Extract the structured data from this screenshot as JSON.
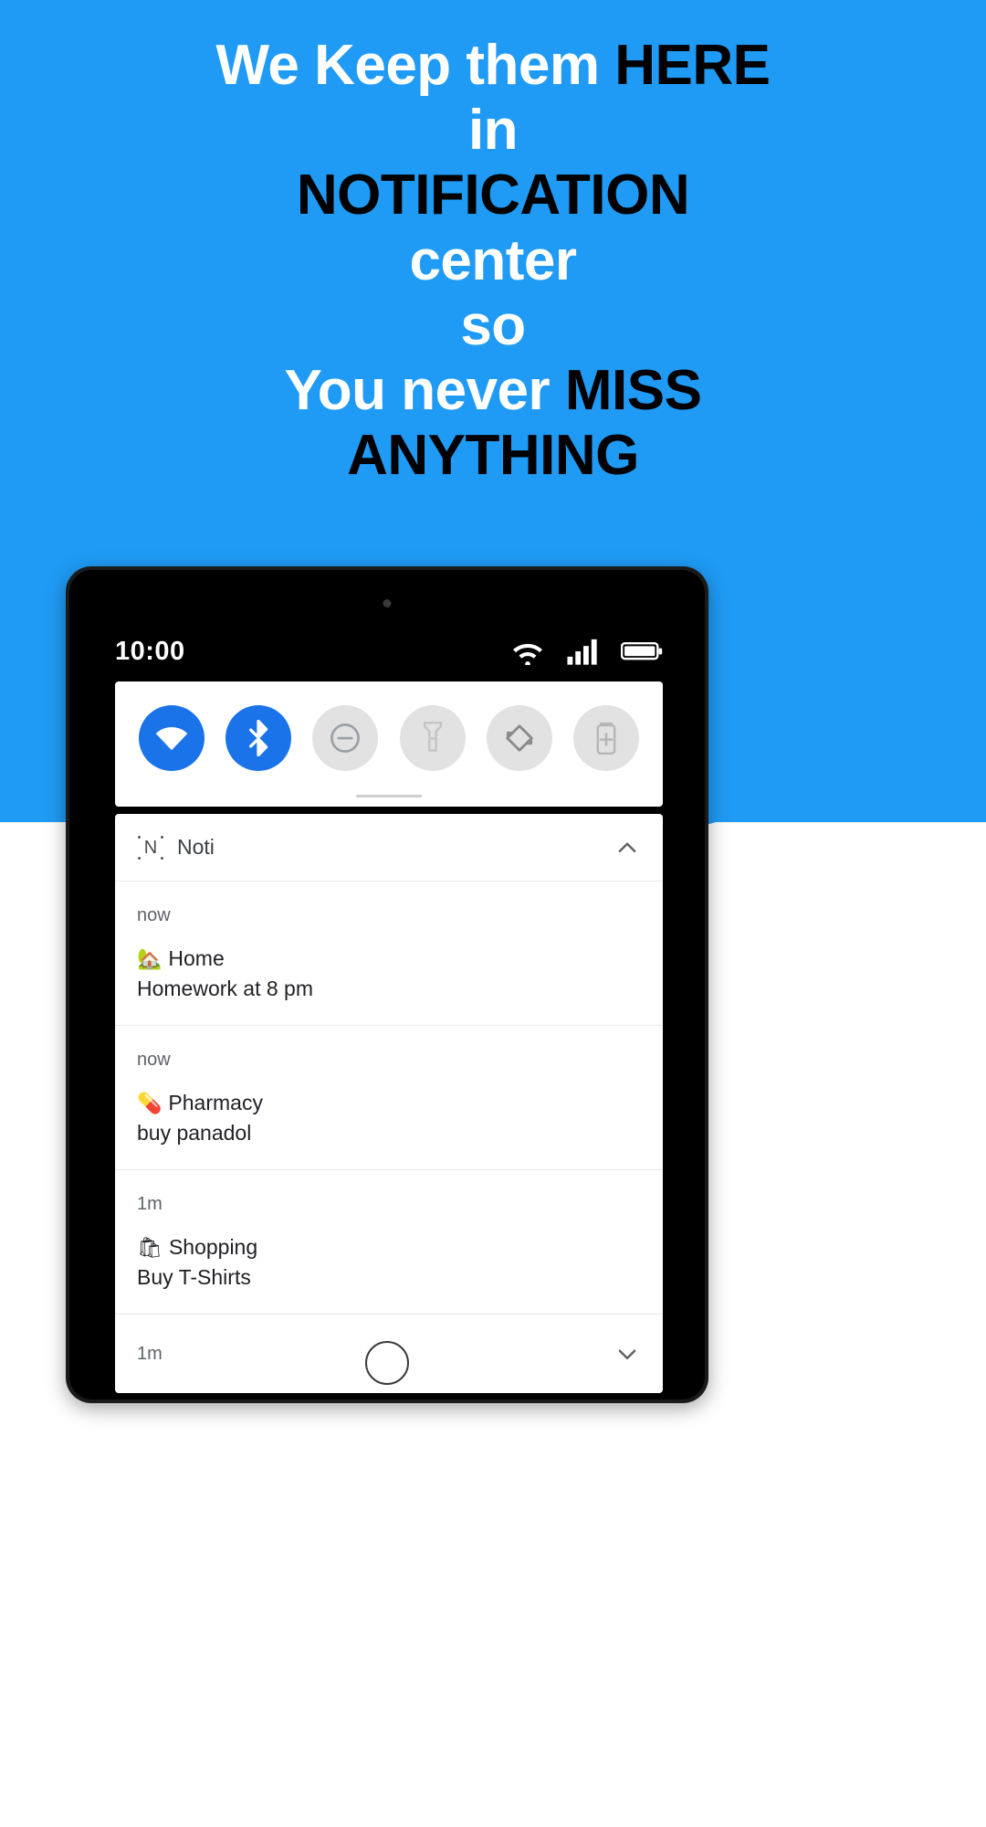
{
  "theme": {
    "brand_blue": "#1f9bf5",
    "tile_active_blue": "#1a73e8",
    "tile_inactive_gray": "#e2e2e2",
    "headline_white": "#ffffff",
    "headline_black": "#000000"
  },
  "headline": {
    "lines": [
      {
        "parts": [
          {
            "text": "We Keep them ",
            "color": "white"
          },
          {
            "text": "HERE",
            "color": "black"
          }
        ]
      },
      {
        "parts": [
          {
            "text": "in",
            "color": "white"
          }
        ]
      },
      {
        "parts": [
          {
            "text": "NOTIFICATION",
            "color": "black"
          }
        ]
      },
      {
        "parts": [
          {
            "text": "center",
            "color": "white"
          }
        ]
      },
      {
        "parts": [
          {
            "text": "so",
            "color": "white"
          }
        ]
      },
      {
        "parts": [
          {
            "text": "You never ",
            "color": "white"
          },
          {
            "text": "MISS",
            "color": "black"
          }
        ]
      },
      {
        "parts": [
          {
            "text": "ANYTHING",
            "color": "black"
          }
        ]
      }
    ],
    "line1_white": "We Keep them ",
    "line1_black": "HERE",
    "line2_white": "in",
    "line3_black": "NOTIFICATION",
    "line4_white": "center",
    "line5_white": "so",
    "line6_white": "You never ",
    "line6_black": "MISS",
    "line7_black": "ANYTHING"
  },
  "device": {
    "statusbar": {
      "time": "10:00",
      "icons": [
        {
          "name": "wifi-icon",
          "label": "Wi-Fi"
        },
        {
          "name": "signal-bars-icon",
          "label": "Cellular signal",
          "bars": 4
        },
        {
          "name": "battery-icon",
          "label": "Battery"
        }
      ]
    },
    "quick_settings": {
      "tiles": [
        {
          "name": "wifi-tile",
          "icon": "wifi-icon",
          "label": "Wi-Fi",
          "active": true
        },
        {
          "name": "bluetooth-tile",
          "icon": "bluetooth-icon",
          "label": "Bluetooth",
          "active": true
        },
        {
          "name": "dnd-tile",
          "icon": "do-not-disturb-icon",
          "label": "Do Not Disturb",
          "active": false
        },
        {
          "name": "flashlight-tile",
          "icon": "flashlight-icon",
          "label": "Flashlight",
          "active": false
        },
        {
          "name": "autorotate-tile",
          "icon": "auto-rotate-icon",
          "label": "Auto-rotate",
          "active": false
        },
        {
          "name": "battery-saver-tile",
          "icon": "battery-saver-icon",
          "label": "Battery Saver",
          "active": false
        }
      ]
    },
    "notification_shade": {
      "app_icon_letter": "N",
      "app_name": "Noti",
      "header_chevron": "chevron-up-icon",
      "footer_chevron": "chevron-down-icon",
      "notifications": [
        {
          "time": "now",
          "emoji": "🏡",
          "title": "Home",
          "text": "Homework at 8 pm"
        },
        {
          "time": "now",
          "emoji": "💊",
          "title": "Pharmacy",
          "text": "buy panadol"
        },
        {
          "time": "1m",
          "emoji": "🛍",
          "title": "Shopping",
          "text": "Buy T-Shirts"
        }
      ],
      "collapsed_notification": {
        "time": "1m"
      }
    },
    "home_button": "home-button"
  }
}
